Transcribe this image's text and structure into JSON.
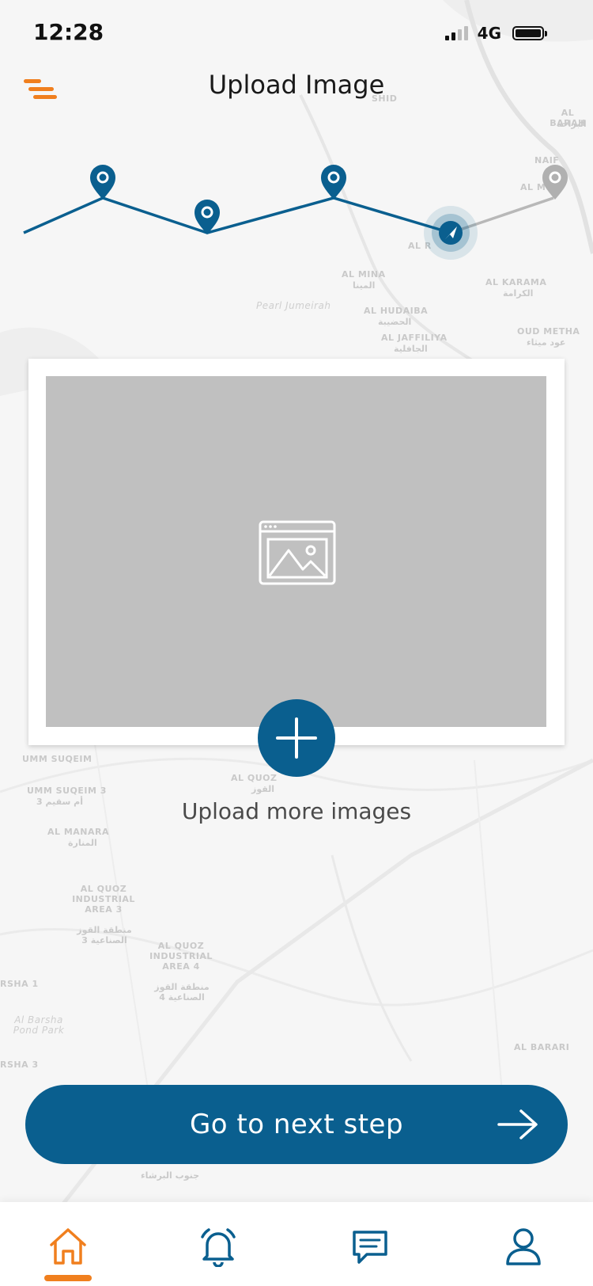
{
  "status_bar": {
    "time": "12:28",
    "network": "4G"
  },
  "header": {
    "title": "Upload Image",
    "menu_icon": "menu-icon"
  },
  "map_labels": [
    "SHID",
    "AL BARAH",
    "البراحة",
    "NAIF",
    "AL M",
    "AL R",
    "AL MINA",
    "المينا",
    "AL KARAMA",
    "الكرامة",
    "Pearl Jumeirah",
    "AL HUDAIBA",
    "الحضيبة",
    "AL JAFFILIYA",
    "الجافلية",
    "OUD METHA",
    "عود ميثاء",
    "UMM SUQEIM",
    "UMM SUQEIM 3",
    "أم سقيم 3",
    "AL QUOZ",
    "القوز",
    "AL MANARA",
    "المنارة",
    "AL QUOZ INDUSTRIAL AREA 3",
    "منطقة القوز الصناعية 3",
    "AL QUOZ INDUSTRIAL AREA 4",
    "منطقة القوز الصناعية 4",
    "RSHA 1",
    "Al Barsha Pond Park",
    "RSHA 3",
    "AL BARARI",
    "جنوب البرشاء"
  ],
  "upload": {
    "placeholder_icon": "image-icon",
    "add_icon": "plus-icon",
    "more_label": "Upload more images"
  },
  "next_button": {
    "label": "Go to next step",
    "icon": "arrow-right-icon"
  },
  "tabs": [
    {
      "name": "home",
      "icon": "home-icon",
      "active": true
    },
    {
      "name": "notifications",
      "icon": "bell-icon",
      "active": false
    },
    {
      "name": "messages",
      "icon": "chat-icon",
      "active": false
    },
    {
      "name": "profile",
      "icon": "user-icon",
      "active": false
    }
  ],
  "colors": {
    "primary": "#0a5f8f",
    "accent": "#f07f1e",
    "placeholder": "#c0c0c0",
    "inactive_route": "#b8b8b8"
  }
}
